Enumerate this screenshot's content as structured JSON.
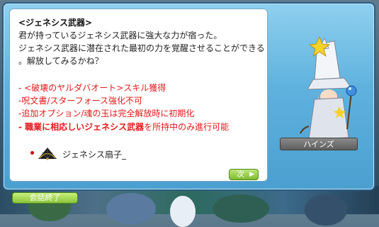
{
  "dialog": {
    "title": "<ジェネシス武器>",
    "lines": [
      "君が持っているジェネシス武器に強大な力が宿った。",
      "ジェネシス武器に潜在された最初の力を覚醒させることができる",
      "。解放してみるかね？"
    ],
    "conditions": [
      "- <破壊のヤルダバオート>スキル獲得",
      "-呪文書/スターフォース強化不可",
      "-追加オプション/魂の玉は完全解放時に初期化"
    ],
    "job_line": {
      "bold_part": "- 職業に相応しいジェネシス武器",
      "rest": "を所持中のみ進行可能"
    },
    "item_name": "ジェネシス扇子_"
  },
  "npc": {
    "name": "ハインズ"
  },
  "buttons": {
    "next": "次",
    "end": "会話終了"
  },
  "colors": {
    "accent_red": "#e01a1a",
    "frame_blue": "#5fb2de",
    "button_green": "#8bc53a"
  }
}
